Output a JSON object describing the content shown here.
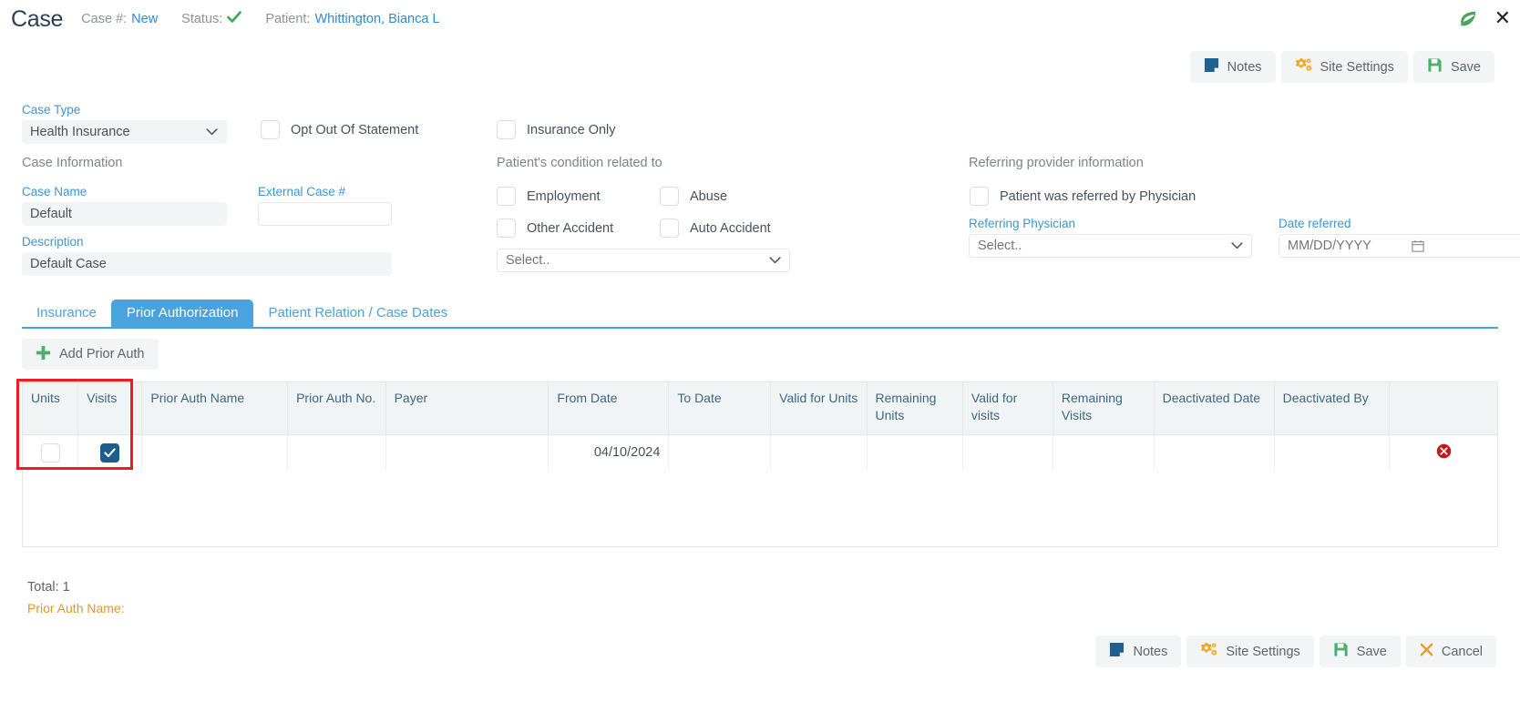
{
  "header": {
    "title": "Case",
    "case_number_label": "Case #:",
    "case_number_value": "New",
    "status_label": "Status:",
    "status_icon": "check-icon",
    "patient_label": "Patient:",
    "patient_value": "Whittington, Bianca L",
    "leaf_icon": "leaf-icon",
    "close_icon": "close-icon"
  },
  "toolbar_top": {
    "notes_label": "Notes",
    "site_settings_label": "Site Settings",
    "save_label": "Save"
  },
  "toolbar_bottom": {
    "notes_label": "Notes",
    "site_settings_label": "Site Settings",
    "save_label": "Save",
    "cancel_label": "Cancel"
  },
  "form": {
    "case_type_label": "Case Type",
    "case_type_value": "Health Insurance",
    "opt_out_label": "Opt Out Of Statement",
    "opt_out_checked": false,
    "insurance_only_label": "Insurance Only",
    "insurance_only_checked": false,
    "case_information_label": "Case Information",
    "case_name_label": "Case Name",
    "case_name_value": "Default",
    "external_case_label": "External Case #",
    "external_case_value": "",
    "description_label": "Description",
    "description_value": "Default Case",
    "condition_section_label": "Patient's condition related to",
    "employment_label": "Employment",
    "employment_checked": false,
    "abuse_label": "Abuse",
    "abuse_checked": false,
    "other_accident_label": "Other Accident",
    "other_accident_checked": false,
    "auto_accident_label": "Auto Accident",
    "auto_accident_checked": false,
    "state_select_placeholder": "Select..",
    "referring_section_label": "Referring provider information",
    "referred_by_physician_label": "Patient was referred by Physician",
    "referred_by_physician_checked": false,
    "referring_physician_label": "Referring Physician",
    "referring_physician_placeholder": "Select..",
    "date_referred_label": "Date referred",
    "date_referred_placeholder": "MM/DD/YYYY"
  },
  "tabs": [
    {
      "label": "Insurance",
      "active": false
    },
    {
      "label": "Prior Authorization",
      "active": true
    },
    {
      "label": "Patient Relation / Case Dates",
      "active": false
    }
  ],
  "add_button": {
    "label": "Add Prior Auth",
    "icon": "plus-icon"
  },
  "table": {
    "columns": [
      "Units",
      "Visits",
      "Prior Auth Name",
      "Prior Auth No.",
      "Payer",
      "From Date",
      "To Date",
      "Valid for Units",
      "Remaining Units",
      "Valid for visits",
      "Remaining Visits",
      "Deactivated Date",
      "Deactivated By",
      ""
    ],
    "rows": [
      {
        "units_checked": false,
        "visits_checked": true,
        "prior_auth_name": "",
        "prior_auth_no": "",
        "payer": "",
        "from_date": "04/10/2024",
        "to_date": "",
        "valid_for_units": "",
        "remaining_units": "",
        "valid_for_visits": "",
        "remaining_visits": "",
        "deactivated_date": "",
        "deactivated_by": "",
        "delete_icon": "delete-icon"
      }
    ]
  },
  "footer": {
    "total_label": "Total: 1",
    "prior_auth_name_label": "Prior Auth Name:"
  },
  "colors": {
    "accent_blue": "#4ba3dd",
    "link_blue": "#2e8bd0",
    "label_blue": "#3e95d3",
    "green": "#3ba856",
    "orange": "#e0972a",
    "red_highlight": "#ef1b22",
    "checkbox_blue": "#1b5e8e"
  }
}
